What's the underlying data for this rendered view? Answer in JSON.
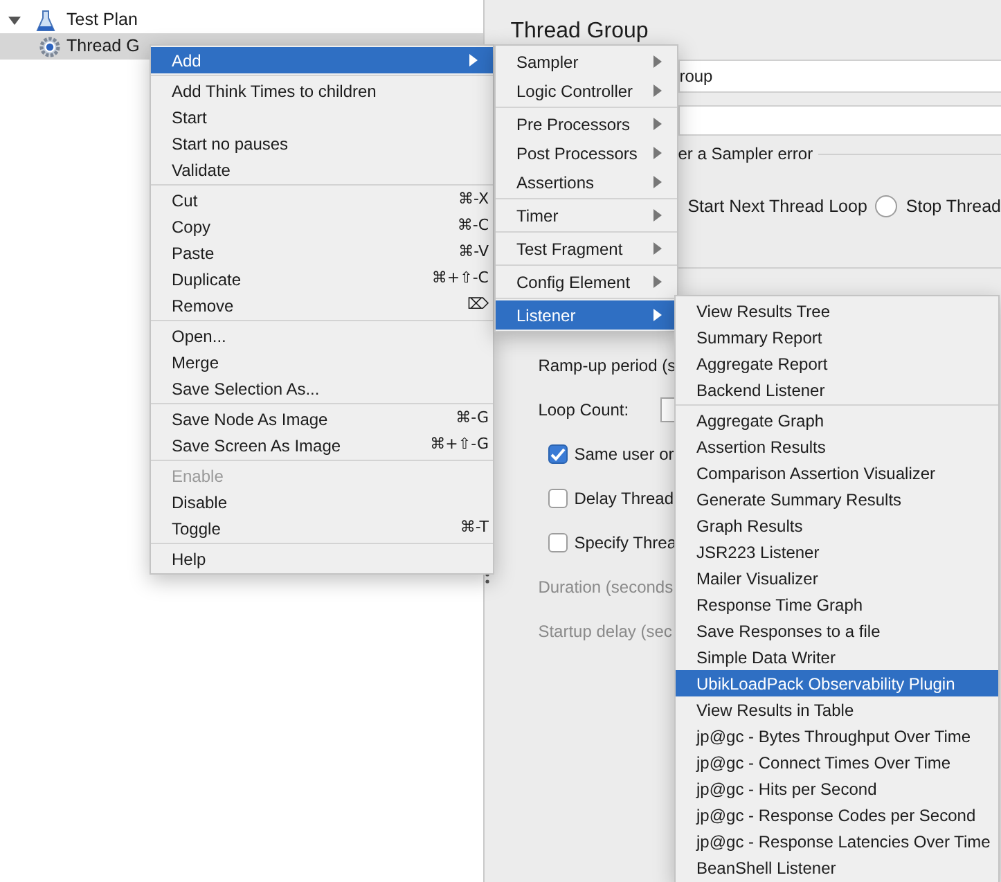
{
  "tree": [
    {
      "label": "Test Plan",
      "kind": "plan",
      "expanded": true,
      "selected": false,
      "children": [
        {
          "label": "Thread G",
          "kind": "thread",
          "selected": true
        }
      ]
    }
  ],
  "panel": {
    "title": "Thread Group",
    "name_value": "roup",
    "error_group": {
      "legend": "er a Sampler error",
      "options": [
        {
          "label": "Start Next Thread Loop"
        },
        {
          "label": "Stop Thread",
          "selected": false
        }
      ]
    },
    "properties": [
      {
        "kind": "label",
        "label": "Ramp-up period (s",
        "disabled": false
      },
      {
        "kind": "field",
        "label": "Loop Count:",
        "disabled": false
      },
      {
        "kind": "checkbox",
        "label": "Same user or",
        "checked": true,
        "disabled": false
      },
      {
        "kind": "checkbox",
        "label": "Delay Thread",
        "checked": false,
        "disabled": false
      },
      {
        "kind": "checkbox",
        "label": "Specify Threa",
        "checked": false,
        "disabled": false
      },
      {
        "kind": "label",
        "label": "Duration (seconds",
        "disabled": true
      },
      {
        "kind": "label",
        "label": "Startup delay (sec",
        "disabled": true
      }
    ]
  },
  "context_menu": {
    "groups": [
      [
        {
          "label": "Add",
          "has_submenu": true,
          "selected": true,
          "disabled": false
        }
      ],
      [
        {
          "label": "Add Think Times to children",
          "has_submenu": false,
          "selected": false,
          "disabled": false
        },
        {
          "label": "Start",
          "has_submenu": false,
          "selected": false,
          "disabled": false
        },
        {
          "label": "Start no pauses",
          "has_submenu": false,
          "selected": false,
          "disabled": false
        },
        {
          "label": "Validate",
          "has_submenu": false,
          "selected": false,
          "disabled": false
        }
      ],
      [
        {
          "label": "Cut",
          "shortcut": "⌘-X",
          "has_submenu": false,
          "selected": false,
          "disabled": false
        },
        {
          "label": "Copy",
          "shortcut": "⌘-C",
          "has_submenu": false,
          "selected": false,
          "disabled": false
        },
        {
          "label": "Paste",
          "shortcut": "⌘-V",
          "has_submenu": false,
          "selected": false,
          "disabled": false
        },
        {
          "label": "Duplicate",
          "shortcut": "⌘+⇧-C",
          "has_submenu": false,
          "selected": false,
          "disabled": false
        },
        {
          "label": "Remove",
          "shortcut": "⌦",
          "has_submenu": false,
          "selected": false,
          "disabled": false
        }
      ],
      [
        {
          "label": "Open...",
          "has_submenu": false,
          "selected": false,
          "disabled": false
        },
        {
          "label": "Merge",
          "has_submenu": false,
          "selected": false,
          "disabled": false
        },
        {
          "label": "Save Selection As...",
          "has_submenu": false,
          "selected": false,
          "disabled": false
        }
      ],
      [
        {
          "label": "Save Node As Image",
          "shortcut": "⌘-G",
          "has_submenu": false,
          "selected": false,
          "disabled": false
        },
        {
          "label": "Save Screen As Image",
          "shortcut": "⌘+⇧-G",
          "has_submenu": false,
          "selected": false,
          "disabled": false
        }
      ],
      [
        {
          "label": "Enable",
          "has_submenu": false,
          "selected": false,
          "disabled": true
        },
        {
          "label": "Disable",
          "has_submenu": false,
          "selected": false,
          "disabled": false
        },
        {
          "label": "Toggle",
          "shortcut": "⌘-T",
          "has_submenu": false,
          "selected": false,
          "disabled": false
        }
      ],
      [
        {
          "label": "Help",
          "has_submenu": false,
          "selected": false,
          "disabled": false
        }
      ]
    ]
  },
  "add_submenu": {
    "groups": [
      [
        {
          "label": "Sampler",
          "has_submenu": true,
          "selected": false
        },
        {
          "label": "Logic Controller",
          "has_submenu": true,
          "selected": false
        }
      ],
      [
        {
          "label": "Pre Processors",
          "has_submenu": true,
          "selected": false
        },
        {
          "label": "Post Processors",
          "has_submenu": true,
          "selected": false
        },
        {
          "label": "Assertions",
          "has_submenu": true,
          "selected": false
        }
      ],
      [
        {
          "label": "Timer",
          "has_submenu": true,
          "selected": false
        }
      ],
      [
        {
          "label": "Test Fragment",
          "has_submenu": true,
          "selected": false
        }
      ],
      [
        {
          "label": "Config Element",
          "has_submenu": true,
          "selected": false
        }
      ],
      [
        {
          "label": "Listener",
          "has_submenu": true,
          "selected": true
        }
      ]
    ]
  },
  "listener_submenu": {
    "groups": [
      [
        {
          "label": "View Results Tree",
          "selected": false
        },
        {
          "label": "Summary Report",
          "selected": false
        },
        {
          "label": "Aggregate Report",
          "selected": false
        },
        {
          "label": "Backend Listener",
          "selected": false
        }
      ],
      [
        {
          "label": "Aggregate Graph",
          "selected": false
        },
        {
          "label": "Assertion Results",
          "selected": false
        },
        {
          "label": "Comparison Assertion Visualizer",
          "selected": false
        },
        {
          "label": "Generate Summary Results",
          "selected": false
        },
        {
          "label": "Graph Results",
          "selected": false
        },
        {
          "label": "JSR223 Listener",
          "selected": false
        },
        {
          "label": "Mailer Visualizer",
          "selected": false
        },
        {
          "label": "Response Time Graph",
          "selected": false
        },
        {
          "label": "Save Responses to a file",
          "selected": false
        },
        {
          "label": "Simple Data Writer",
          "selected": false
        },
        {
          "label": "UbikLoadPack Observability Plugin",
          "selected": true
        },
        {
          "label": "View Results in Table",
          "selected": false
        },
        {
          "label": "jp@gc - Bytes Throughput Over Time",
          "selected": false
        },
        {
          "label": "jp@gc - Connect Times Over Time",
          "selected": false
        },
        {
          "label": "jp@gc - Hits per Second",
          "selected": false
        },
        {
          "label": "jp@gc - Response Codes per Second",
          "selected": false
        },
        {
          "label": "jp@gc - Response Latencies Over Time",
          "selected": false
        },
        {
          "label": "BeanShell Listener",
          "selected": false
        }
      ]
    ]
  }
}
